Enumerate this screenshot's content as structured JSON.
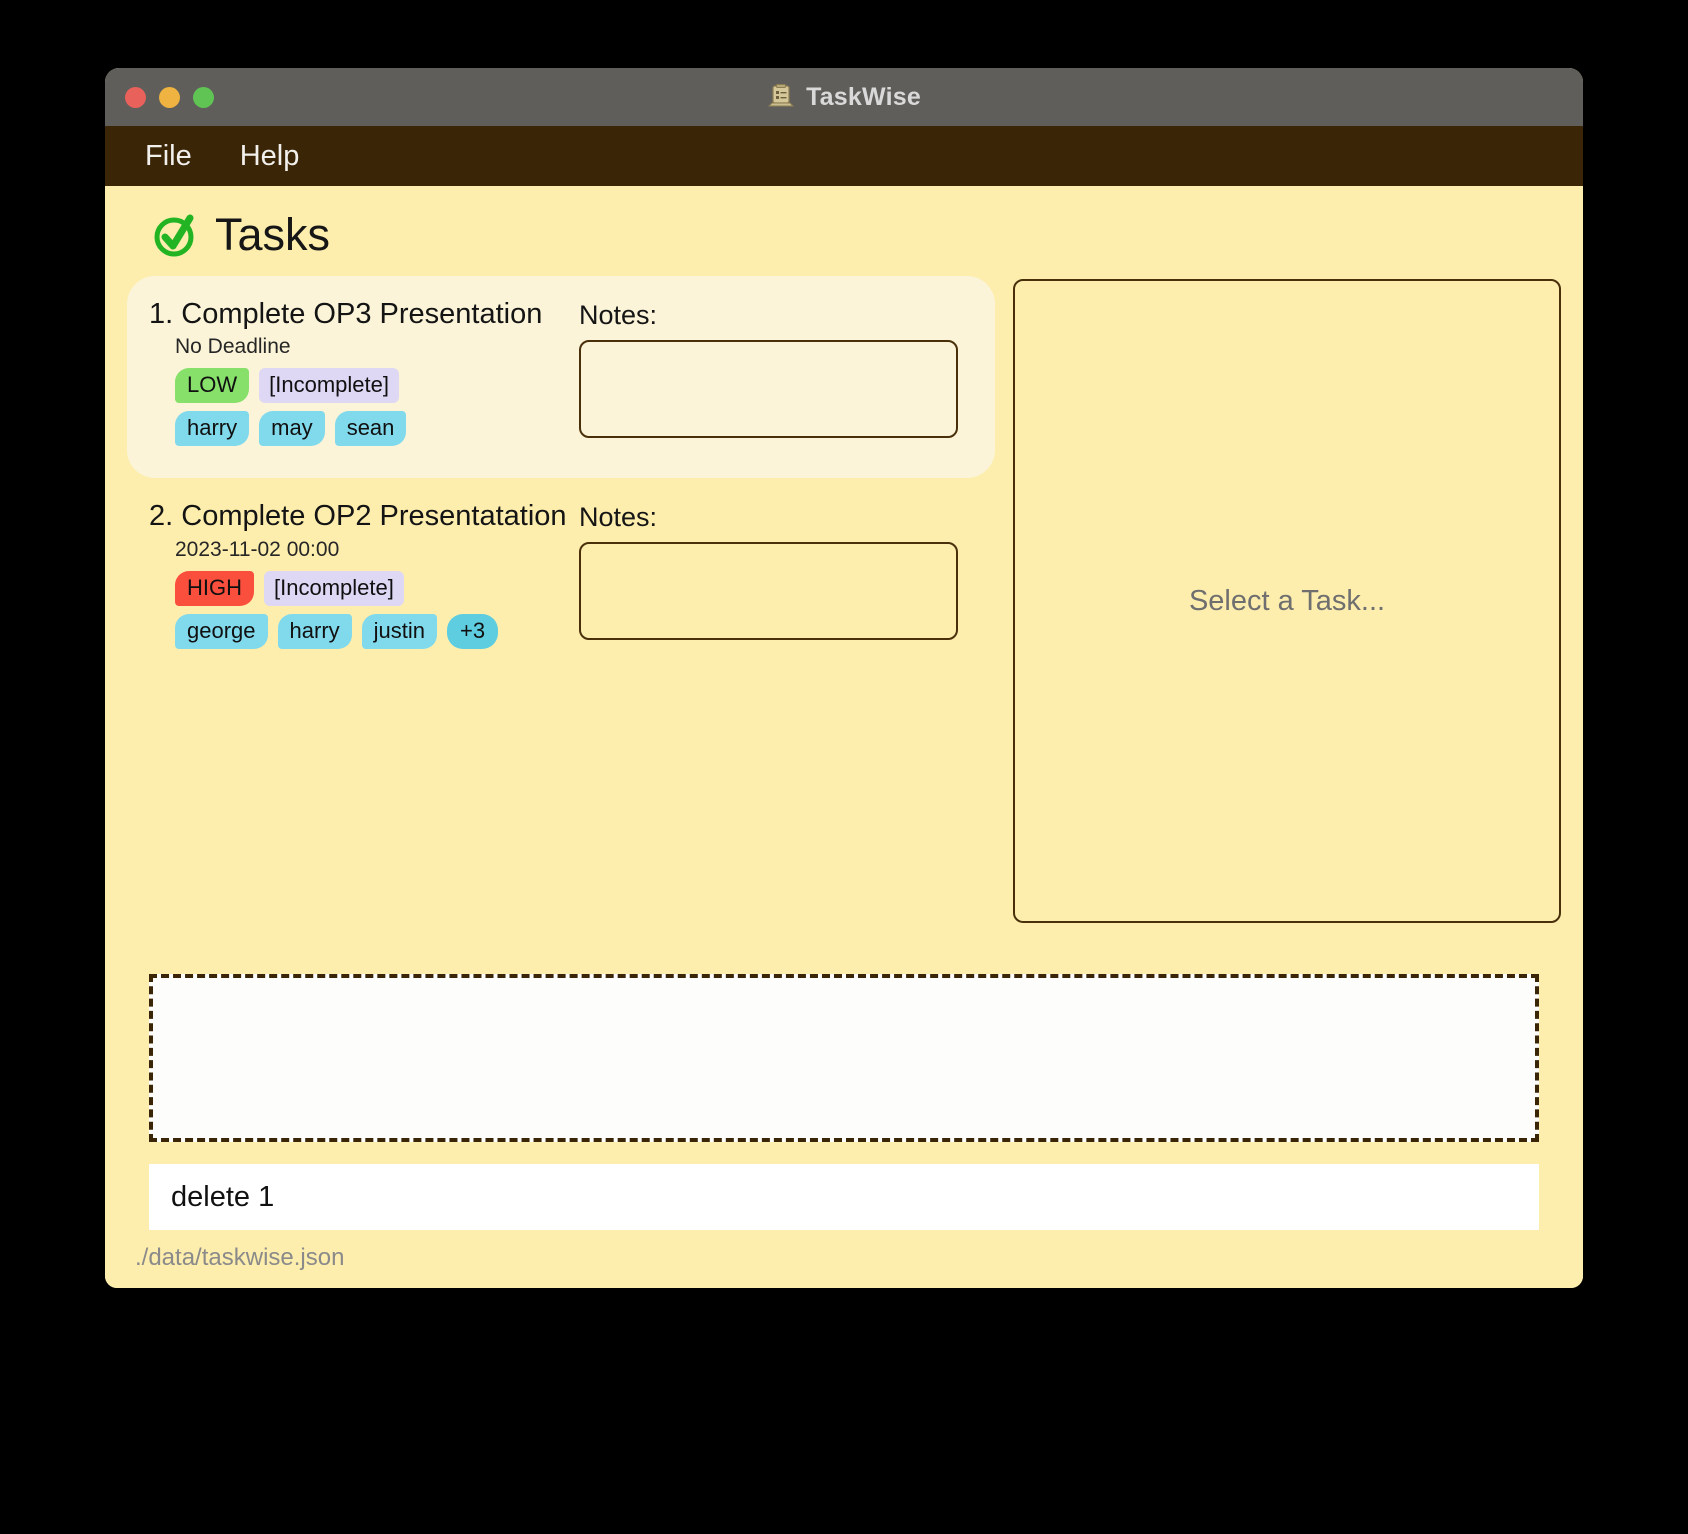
{
  "window": {
    "title": "TaskWise",
    "title_icon": "clipboard-laptop-icon",
    "traffic_lights": [
      "close",
      "minimize",
      "maximize"
    ]
  },
  "menubar": {
    "items": [
      {
        "label": "File"
      },
      {
        "label": "Help"
      }
    ]
  },
  "page": {
    "icon": "green-check-circle-icon",
    "title": "Tasks"
  },
  "tasks": [
    {
      "index": "1.",
      "title": "Complete OP3 Presentation",
      "deadline": "No Deadline",
      "priority": "LOW",
      "status": "[Incomplete]",
      "assignees": [
        "harry",
        "may",
        "sean"
      ],
      "more_count": "",
      "notes_label": "Notes:",
      "notes_value": "",
      "selected": true
    },
    {
      "index": "2.",
      "title": "Complete OP2 Presentatation",
      "deadline": "2023-11-02 00:00",
      "priority": "HIGH",
      "status": "[Incomplete]",
      "assignees": [
        "george",
        "harry",
        "justin"
      ],
      "more_count": "+3",
      "notes_label": "Notes:",
      "notes_value": "",
      "selected": false
    }
  ],
  "detail_panel": {
    "placeholder": "Select a Task..."
  },
  "output": {
    "text": ""
  },
  "command": {
    "value": "delete 1",
    "placeholder": ""
  },
  "statusbar": {
    "path": "./data/taskwise.json"
  },
  "colors": {
    "window_background": "#fdeeae",
    "menubar": "#3a2506",
    "titlebar": "#5f5e5b",
    "selected_card": "#fbf4d8",
    "priority_low": "#87e06a",
    "priority_high": "#fb4f3e",
    "status_chip": "#ded8f5",
    "assignee_chip": "#81d9ec",
    "assignee_more_chip": "#5fcde0",
    "border": "#4a300a"
  }
}
